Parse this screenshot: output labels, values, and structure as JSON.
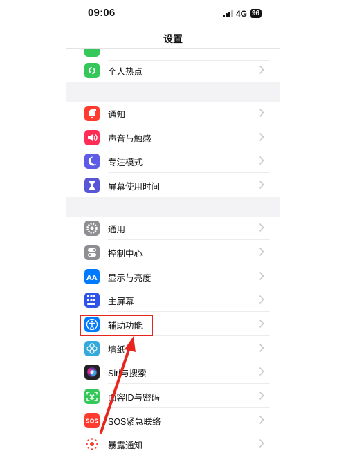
{
  "status_bar": {
    "time": "09:06",
    "network": "4G",
    "battery": "96"
  },
  "nav": {
    "title": "设置"
  },
  "rows": [
    {
      "id": "partial",
      "label": "",
      "color": "#34c759"
    },
    {
      "id": "hotspot",
      "label": "个人热点",
      "color": "#34c759",
      "icon": "hotspot-icon"
    },
    {
      "id": "notifications",
      "label": "通知",
      "color": "#ff3b30",
      "icon": "bell-icon"
    },
    {
      "id": "sounds",
      "label": "声音与触感",
      "color": "#ff2d55",
      "icon": "speaker-icon"
    },
    {
      "id": "focus",
      "label": "专注模式",
      "color": "#5e5ce6",
      "icon": "moon-icon"
    },
    {
      "id": "screen_time",
      "label": "屏幕使用时间",
      "color": "#5856d6",
      "icon": "hourglass-icon"
    },
    {
      "id": "general",
      "label": "通用",
      "color": "#8e8e93",
      "icon": "gear-icon"
    },
    {
      "id": "control_center",
      "label": "控制中心",
      "color": "#8e8e93",
      "icon": "toggles-icon"
    },
    {
      "id": "display",
      "label": "显示与亮度",
      "color": "#007aff",
      "icon": "text-size-icon"
    },
    {
      "id": "home_screen",
      "label": "主屏幕",
      "color": "#2f54eb",
      "icon": "app-grid-icon"
    },
    {
      "id": "accessibility",
      "label": "辅助功能",
      "color": "#007aff",
      "icon": "accessibility-icon"
    },
    {
      "id": "wallpaper",
      "label": "墙纸",
      "color": "#34aadc",
      "icon": "flower-icon"
    },
    {
      "id": "siri",
      "label": "Siri与搜索",
      "color": "#222222",
      "icon": "siri-icon"
    },
    {
      "id": "face_id",
      "label": "面容ID与密码",
      "color": "#34c759",
      "icon": "face-id-icon"
    },
    {
      "id": "sos",
      "label": "SOS紧急联络",
      "color": "#ff3b30",
      "icon": "sos-icon",
      "badge": "SOS"
    },
    {
      "id": "exposure",
      "label": "暴露通知",
      "color": "#ff3b30",
      "icon": "exposure-icon"
    }
  ],
  "colors": {
    "annotation": "#e8251d",
    "group_gap": "#f3f3f5"
  }
}
